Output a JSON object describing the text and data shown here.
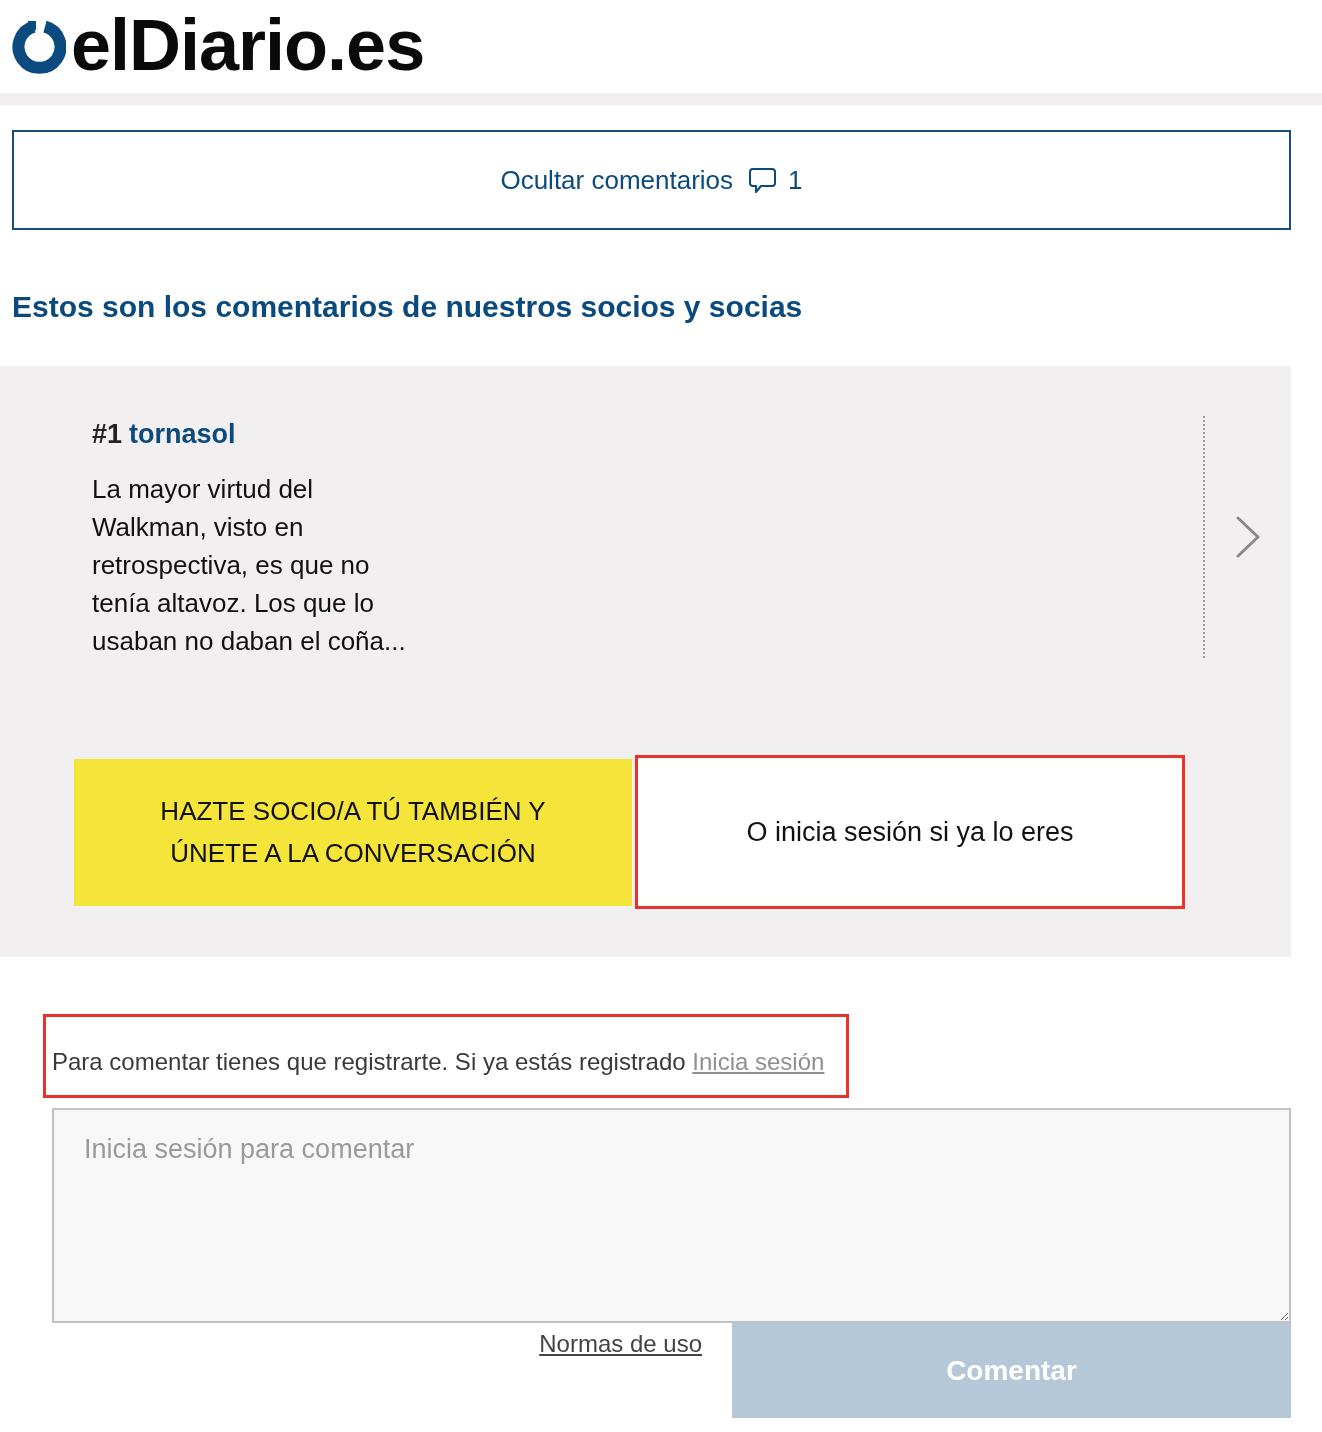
{
  "header": {
    "logo_text": "elDiario.es"
  },
  "comments_toggle": {
    "label": "Ocultar comentarios",
    "count": "1"
  },
  "section_title": "Estos son los comentarios de nuestros socios y socias",
  "comments": [
    {
      "number": "#1",
      "author": "tornasol",
      "text": "La mayor virtud del Walkman, visto en retrospectiva, es que no tenía altavoz. Los que lo usaban no daban el coña..."
    }
  ],
  "cta": {
    "join_label": "HAZTE SOCIO/A TÚ TAMBIÉN Y ÚNETE A LA CONVERSACIÓN",
    "login_label": "O inicia sesión si ya lo eres",
    "login_highlighted": true
  },
  "notice": {
    "text": "Para comentar tienes que registrarte. Si ya estás registrado",
    "link": "Inicia sesión",
    "highlighted": true
  },
  "comment_box": {
    "placeholder": "Inicia sesión para comentar"
  },
  "rules_link": "Normas de uso",
  "submit": {
    "label": "Comentar",
    "disabled": true
  }
}
